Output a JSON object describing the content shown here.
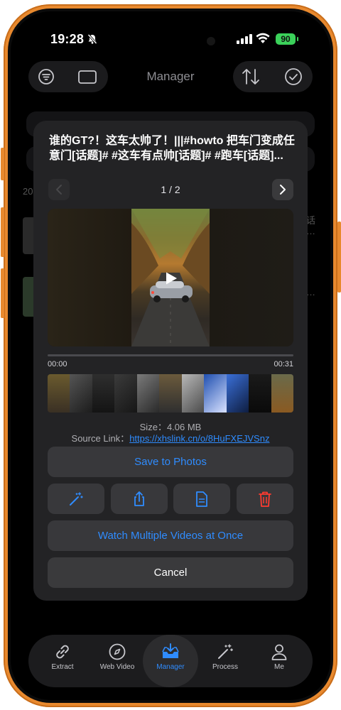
{
  "status_bar": {
    "time": "19:28",
    "battery": "90"
  },
  "nav": {
    "title": "Manager"
  },
  "background": {
    "year_prefix": "20",
    "row1_text": "话",
    "row1_more": "…",
    "row2_more": "…"
  },
  "sheet": {
    "title": "谁的GT?！这车太帅了！|||#howto 把车门变成任意门[话题]# #这车有点帅[话题]# #跑车[话题]...",
    "pager": "1 / 2",
    "time_start": "00:00",
    "time_end": "00:31",
    "size_label": "Size：",
    "size_value": "4.06 MB",
    "source_label": "Source Link：",
    "source_url": "https://xhslink.cn/o/8HuFXEJVSnz",
    "save_label": "Save to Photos",
    "watch_label": "Watch Multiple Videos at Once",
    "cancel_label": "Cancel"
  },
  "tabbar": {
    "items": [
      {
        "label": "Extract",
        "icon": "link-icon"
      },
      {
        "label": "Web Video",
        "icon": "compass-icon"
      },
      {
        "label": "Manager",
        "icon": "tray-download-icon"
      },
      {
        "label": "Process",
        "icon": "magic-wand-icon"
      },
      {
        "label": "Me",
        "icon": "person-icon"
      }
    ]
  },
  "colors": {
    "accent": "#2f8cff",
    "danger": "#ff3b30",
    "frame": "#e8892e"
  }
}
